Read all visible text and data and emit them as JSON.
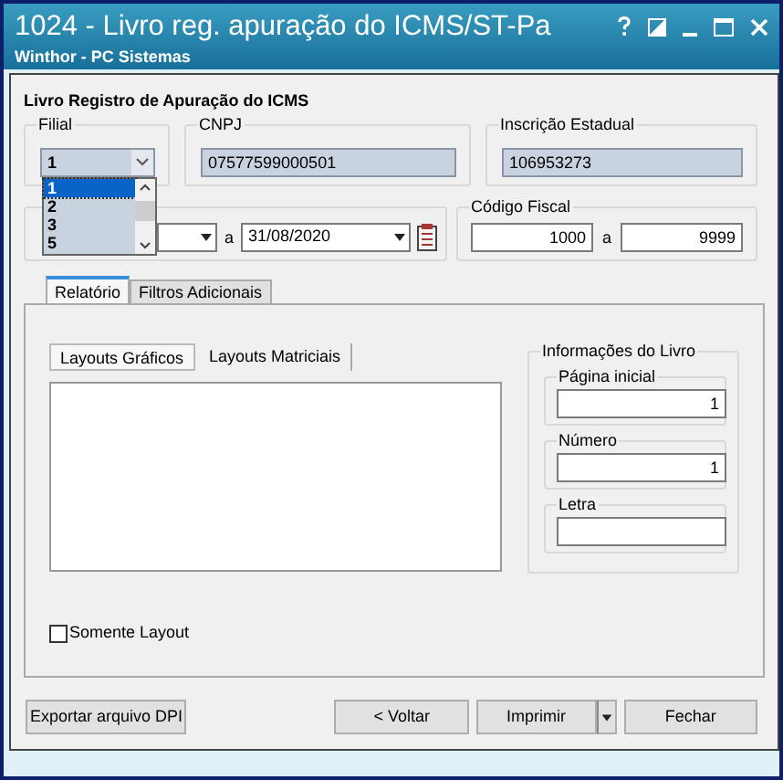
{
  "window": {
    "title": "1024 - Livro reg. apuração do ICMS/ST-Pa",
    "subtitle": "Winthor - PC Sistemas"
  },
  "form_title": "Livro Registro de Apuração do ICMS",
  "filial": {
    "label": "Filial",
    "value": "1",
    "options": [
      {
        "label": "1",
        "selected": true
      },
      {
        "label": "2",
        "selected": false
      },
      {
        "label": "3",
        "selected": false
      },
      {
        "label": "5",
        "selected": false
      }
    ]
  },
  "cnpj": {
    "label": "CNPJ",
    "value": "07577599000501"
  },
  "inscricao_estadual": {
    "label": "Inscrição Estadual",
    "value": "106953273"
  },
  "periodo": {
    "separator": "a",
    "end_date": "31/08/2020"
  },
  "codigo_fiscal": {
    "label": "Código Fiscal",
    "from": "1000",
    "separator": "a",
    "to": "9999"
  },
  "tabs": [
    {
      "label": "Relatório",
      "selected": true
    },
    {
      "label": "Filtros Adicionais",
      "selected": false
    }
  ],
  "layout_tabs": [
    {
      "label": "Layouts Gráficos",
      "selected": true
    },
    {
      "label": "Layouts Matriciais",
      "selected": false
    }
  ],
  "livro": {
    "title": "Informações do Livro",
    "fields": [
      {
        "label": "Página inicial",
        "value": "1"
      },
      {
        "label": "Número",
        "value": "1"
      },
      {
        "label": "Letra"
      }
    ]
  },
  "somente_layout": {
    "label": "Somente Layout",
    "checked": false
  },
  "buttons": [
    {
      "label": "Exportar arquivo DPI",
      "kind": "plain"
    },
    {
      "label": "< Voltar",
      "kind": "plain"
    },
    {
      "label": "Imprimir",
      "kind": "split"
    },
    {
      "label": "Fechar",
      "kind": "plain"
    }
  ]
}
